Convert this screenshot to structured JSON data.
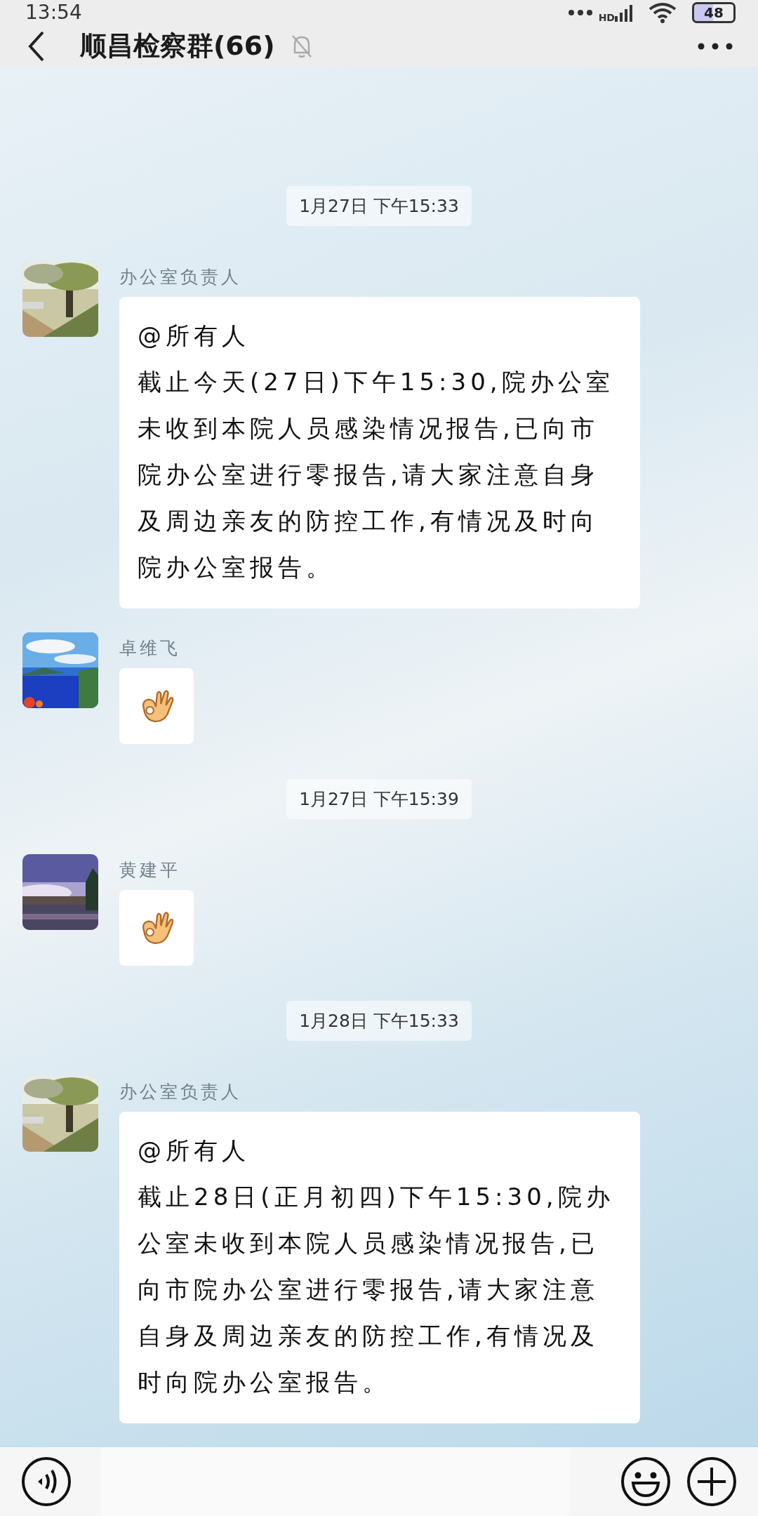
{
  "status_bar": {
    "time": "13:54",
    "network": "HD",
    "battery": "48"
  },
  "header": {
    "title": "顺昌检察群(66)",
    "muted": true
  },
  "messages": [
    {
      "kind": "time",
      "text": "1月27日 下午15:33"
    },
    {
      "kind": "text",
      "sender": "办公室负责人",
      "mention": "@所有人",
      "text": "截止今天(27日)下午15:30,院办公室未收到本院人员感染情况报告,已向市院办公室进行零报告,请大家注意自身及周边亲友的防控工作,有情况及时向院办公室报告。"
    },
    {
      "kind": "emoji",
      "sender": "卓维飞"
    },
    {
      "kind": "time",
      "text": "1月27日 下午15:39"
    },
    {
      "kind": "emoji",
      "sender": "黄建平"
    },
    {
      "kind": "time",
      "text": "1月28日 下午15:33"
    },
    {
      "kind": "text",
      "sender": "办公室负责人",
      "mention": "@所有人",
      "text": "截止28日(正月初四)下午15:30,院办公室未收到本院人员感染情况报告,已向市院办公室进行零报告,请大家注意自身及周边亲友的防控工作,有情况及时向院办公室报告。"
    }
  ]
}
